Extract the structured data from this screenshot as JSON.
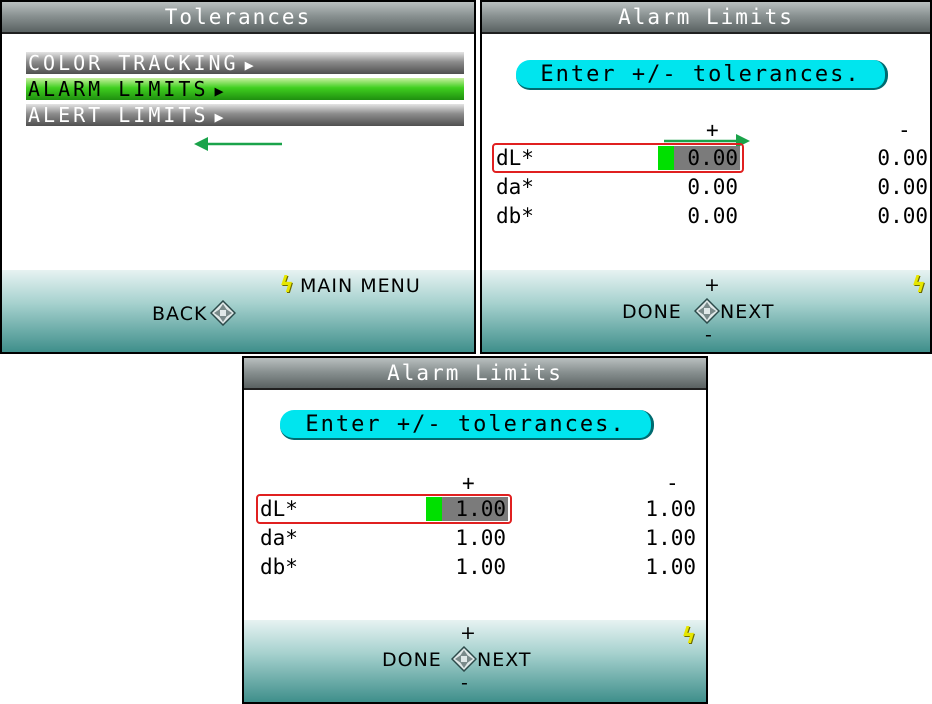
{
  "tolerances_screen": {
    "title": "Tolerances",
    "items": [
      {
        "label": "COLOR TRACKING",
        "arrow": "▶"
      },
      {
        "label": "ALARM LIMITS",
        "arrow": "▶"
      },
      {
        "label": "ALERT LIMITS",
        "arrow": "▶"
      }
    ],
    "selected_index": 1,
    "main_menu_label": "MAIN MENU",
    "back_label": "BACK"
  },
  "alarm_screen_1": {
    "title": "Alarm Limits",
    "prompt": "Enter +/- tolerances.",
    "plus_header": "+",
    "minus_header": "-",
    "rows": [
      {
        "label": "dL*",
        "plus": "0.00",
        "minus": "0.00"
      },
      {
        "label": "da*",
        "plus": "0.00",
        "minus": "0.00"
      },
      {
        "label": "db*",
        "plus": "0.00",
        "minus": "0.00"
      }
    ],
    "plus_key": "+",
    "minus_key": "-",
    "done_label": "DONE",
    "next_label": "NEXT"
  },
  "alarm_screen_2": {
    "title": "Alarm Limits",
    "prompt": "Enter +/- tolerances.",
    "plus_header": "+",
    "minus_header": "-",
    "rows": [
      {
        "label": "dL*",
        "plus": "1.00",
        "minus": "1.00"
      },
      {
        "label": "da*",
        "plus": "1.00",
        "minus": "1.00"
      },
      {
        "label": "db*",
        "plus": "1.00",
        "minus": "1.00"
      }
    ],
    "plus_key": "+",
    "minus_key": "-",
    "done_label": "DONE",
    "next_label": "NEXT"
  },
  "colors": {
    "highlight_green": "#3fcf1f",
    "prompt_cyan": "#00e5ee",
    "selection_red": "#e02020",
    "annotation_green": "#1aa34a",
    "bolt_yellow": "#e6e600"
  },
  "icons": [
    "lightning-bolt-icon",
    "dpad-icon",
    "submenu-arrow-icon",
    "annotation-arrow-icon"
  ]
}
